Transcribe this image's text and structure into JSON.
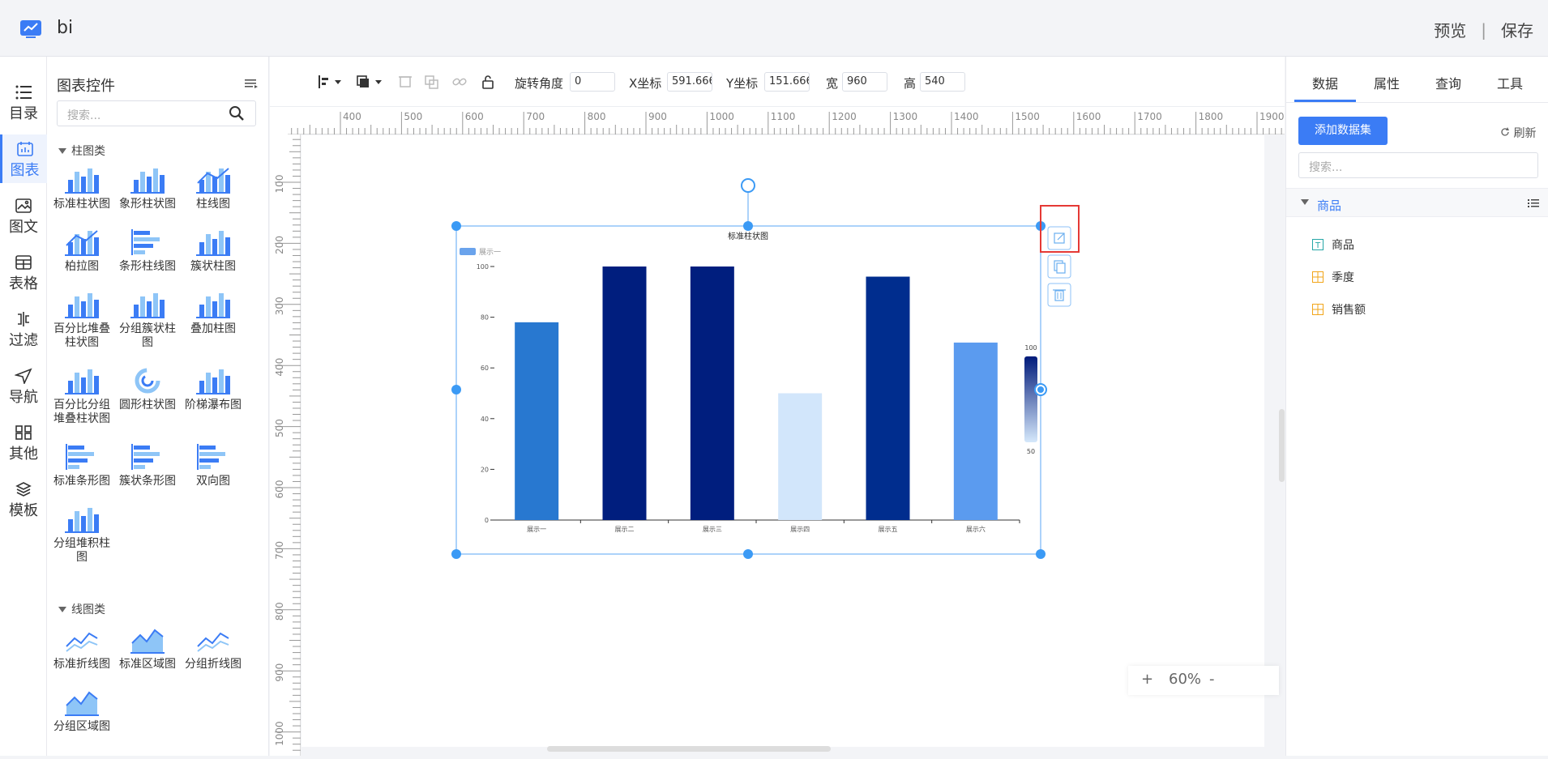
{
  "app": {
    "title": "bi",
    "preview": "预览",
    "separator": "|",
    "save": "保存",
    "accent": "#3b7cf5"
  },
  "rail": {
    "items": [
      {
        "label": "目录",
        "icon": "list-icon"
      },
      {
        "label": "图表",
        "icon": "chart-icon",
        "active": true
      },
      {
        "label": "图文",
        "icon": "image-text-icon"
      },
      {
        "label": "表格",
        "icon": "table-icon"
      },
      {
        "label": "过滤",
        "icon": "filter-icon"
      },
      {
        "label": "导航",
        "icon": "navigation-icon"
      },
      {
        "label": "其他",
        "icon": "grid-icon"
      },
      {
        "label": "模板",
        "icon": "template-icon"
      }
    ]
  },
  "panel": {
    "title": "图表控件",
    "search_placeholder": "搜索...",
    "categories": [
      {
        "name": "柱图类",
        "widgets": [
          "标准柱状图",
          "象形柱状图",
          "柱线图",
          "柏拉图",
          "条形柱线图",
          "簇状柱图",
          "百分比堆叠柱状图",
          "分组簇状柱图",
          "叠加柱图",
          "百分比分组堆叠柱状图",
          "圆形柱状图",
          "阶梯瀑布图",
          "标准条形图",
          "簇状条形图",
          "双向图",
          "分组堆积柱图"
        ]
      },
      {
        "name": "线图类",
        "widgets": [
          "标准折线图",
          "标准区域图",
          "分组折线图",
          "分组区域图"
        ]
      }
    ]
  },
  "toolbar": {
    "rotate_label": "旋转角度",
    "rotate_value": "0",
    "x_label": "X坐标",
    "x_value": "591.666",
    "y_label": "Y坐标",
    "y_value": "151.666",
    "w_label": "宽",
    "w_value": "960",
    "h_label": "高",
    "h_value": "540"
  },
  "rulers": {
    "h_labels": [
      "400",
      "500",
      "600",
      "700",
      "800",
      "900",
      "1000",
      "1100",
      "1200",
      "1300",
      "1400",
      "1500",
      "1600",
      "1700",
      "1800",
      "1900"
    ],
    "v_labels": [
      "100",
      "200",
      "300",
      "400",
      "500",
      "600",
      "700",
      "800",
      "900",
      "1000"
    ]
  },
  "chart_data": {
    "type": "bar",
    "title": "标准柱状图",
    "legend": [
      "展示一"
    ],
    "legend_position": "top-left",
    "categories": [
      "展示一",
      "展示二",
      "展示三",
      "展示四",
      "展示五",
      "展示六"
    ],
    "values": [
      78,
      100,
      100,
      50,
      96,
      70
    ],
    "ylim": [
      0,
      100
    ],
    "yticks": [
      "0",
      "20",
      "40",
      "60",
      "80",
      "100"
    ],
    "visual_map": {
      "max": "100",
      "min": "50",
      "color_high": "#001a7a",
      "color_low": "#d5e8fb"
    },
    "bar_colors": [
      "#2878d0",
      "#001e7e",
      "#001e7e",
      "#d2e6fb",
      "#002d8e",
      "#5b9bef"
    ],
    "grid": false
  },
  "zoom": {
    "plus": "+",
    "level": "60%",
    "minus": "-"
  },
  "right": {
    "tabs": [
      "数据",
      "属性",
      "查询",
      "工具"
    ],
    "add_dataset": "添加数据集",
    "refresh": "刷新",
    "search_placeholder": "搜索...",
    "dataset": "商品",
    "fields": [
      {
        "name": "商品",
        "type": "text"
      },
      {
        "name": "季度",
        "type": "dimension"
      },
      {
        "name": "销售额",
        "type": "measure"
      }
    ]
  }
}
